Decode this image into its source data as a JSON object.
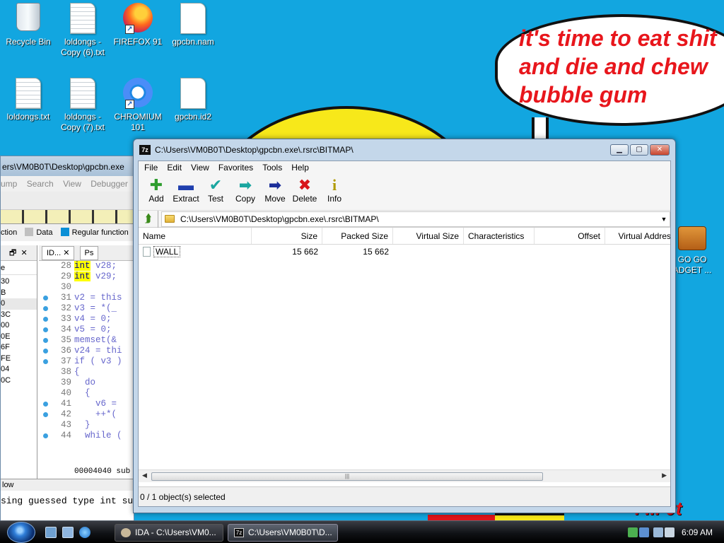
{
  "desktop": {
    "icons": [
      {
        "label": "Recycle Bin"
      },
      {
        "label": "loldongs - Copy (6).txt"
      },
      {
        "label": "FIREFOX 91"
      },
      {
        "label": "gpcbn.nam"
      },
      {
        "label": "loldongs.txt"
      },
      {
        "label": "loldongs - Copy (7).txt"
      },
      {
        "label": "CHROMIUM 101"
      },
      {
        "label": "gpcbn.id2"
      },
      {
        "label": "GO GO ADGET ..."
      }
    ],
    "wallpaper_text": "it's time to eat shit and die and chew bubble gum",
    "wallpaper_scrawl": "ı ııı 0t"
  },
  "ida": {
    "title": "ers\\VM0B0T\\Desktop\\gpcbn.exe",
    "menu": [
      "ump",
      "Search",
      "View",
      "Debugger"
    ],
    "legend": {
      "item1": "ction",
      "item2": "Data",
      "item3": "Regular function"
    },
    "left_pane_header": "e",
    "left_addresses": [
      "30",
      "B",
      "0",
      "3C",
      "00",
      "0E",
      "6F",
      "FE",
      "04",
      "0C"
    ],
    "tab_label": "ID...",
    "tab2_label": "Ps",
    "code_lines": [
      {
        "num": "28",
        "kw": "int",
        "rest": " v28;"
      },
      {
        "num": "29",
        "kw": "int",
        "rest": " v29;"
      },
      {
        "num": "30",
        "kw": "",
        "rest": ""
      },
      {
        "num": "31",
        "kw": "",
        "rest": "v2 = this"
      },
      {
        "num": "32",
        "kw": "",
        "rest": "v3 = *(_"
      },
      {
        "num": "33",
        "kw": "",
        "rest": "v4 = 0;"
      },
      {
        "num": "34",
        "kw": "",
        "rest": "v5 = 0;"
      },
      {
        "num": "35",
        "kw": "",
        "rest": "memset(&"
      },
      {
        "num": "36",
        "kw": "",
        "rest": "v24 = thi"
      },
      {
        "num": "37",
        "kw": "",
        "rest": "if ( v3 )"
      },
      {
        "num": "38",
        "kw": "",
        "rest": "{"
      },
      {
        "num": "39",
        "kw": "",
        "rest": "  do"
      },
      {
        "num": "40",
        "kw": "",
        "rest": "  {"
      },
      {
        "num": "41",
        "kw": "",
        "rest": "    v6 ="
      },
      {
        "num": "42",
        "kw": "",
        "rest": "    ++*("
      },
      {
        "num": "43",
        "kw": "",
        "rest": "  }"
      },
      {
        "num": "44",
        "kw": "",
        "rest": "  while ("
      }
    ],
    "code_status": "00004040 sub",
    "output_title": "low",
    "output_text": "sing guessed type int su"
  },
  "zip": {
    "title": "C:\\Users\\VM0B0T\\Desktop\\gpcbn.exe\\.rsrc\\BITMAP\\",
    "app_icon_text": "7z",
    "menu": [
      "File",
      "Edit",
      "View",
      "Favorites",
      "Tools",
      "Help"
    ],
    "toolbar": [
      {
        "label": "Add",
        "icon": "plus-icon",
        "glyph": "✚",
        "color": "#2e9d2e"
      },
      {
        "label": "Extract",
        "icon": "minus-icon",
        "glyph": "▬",
        "color": "#1f3fae"
      },
      {
        "label": "Test",
        "icon": "check-icon",
        "glyph": "✔",
        "color": "#1aa6a0"
      },
      {
        "label": "Copy",
        "icon": "arrow-right-icon",
        "glyph": "➡",
        "color": "#1aa6a0"
      },
      {
        "label": "Move",
        "icon": "arrow-right-icon",
        "glyph": "➡",
        "color": "#1c2f9a"
      },
      {
        "label": "Delete",
        "icon": "x-icon",
        "glyph": "✖",
        "color": "#d8161c"
      },
      {
        "label": "Info",
        "icon": "info-icon",
        "glyph": "i",
        "color": "#b09a00"
      }
    ],
    "address": "C:\\Users\\VM0B0T\\Desktop\\gpcbn.exe\\.rsrc\\BITMAP\\",
    "columns": [
      "Name",
      "Size",
      "Packed Size",
      "Virtual Size",
      "Characteristics",
      "Offset",
      "Virtual Addres"
    ],
    "rows": [
      {
        "name": "WALL",
        "size": "15 662",
        "packed": "15 662"
      }
    ],
    "status": "0 / 1 object(s) selected"
  },
  "taskbar": {
    "tasks": [
      {
        "label": "IDA - C:\\Users\\VM0..."
      },
      {
        "label": "C:\\Users\\VM0B0T\\D..."
      }
    ],
    "clock": "6:09 AM"
  }
}
